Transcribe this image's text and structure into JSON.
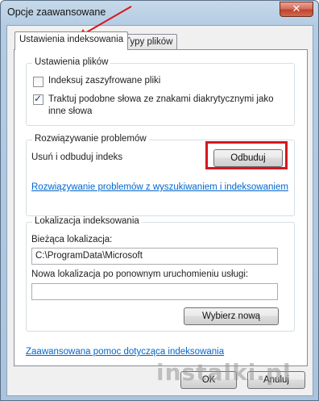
{
  "window": {
    "title": "Opcje zaawansowane",
    "close_glyph": "✕"
  },
  "tabs": [
    {
      "label": "Ustawienia indeksowania",
      "active": true
    },
    {
      "label": "Typy plików",
      "active": false
    }
  ],
  "file_settings": {
    "title": "Ustawienia plików",
    "options": [
      {
        "label": "Indeksuj zaszyfrowane pliki",
        "checked": false
      },
      {
        "label": "Traktuj podobne słowa ze znakami diakrytycznymi jako inne słowa",
        "checked": true
      }
    ]
  },
  "troubleshooting": {
    "title": "Rozwiązywanie problemów",
    "rebuild_label": "Usuń i odbuduj indeks",
    "rebuild_button": "Odbuduj",
    "help_link": "Rozwiązywanie problemów z wyszukiwaniem i indeksowaniem"
  },
  "index_location": {
    "title": "Lokalizacja indeksowania",
    "current_label": "Bieżąca lokalizacja:",
    "current_value": "C:\\ProgramData\\Microsoft",
    "new_label": "Nowa lokalizacja po ponownym uruchomieniu usługi:",
    "new_value": "",
    "select_button": "Wybierz nową"
  },
  "advanced_help_link": "Zaawansowana pomoc dotycząca indeksowania",
  "footer": {
    "ok_label": "OK",
    "cancel_label": "Anuluj"
  },
  "watermark": "instalki.pl",
  "colors": {
    "highlight": "#d6161f",
    "link": "#0066cc"
  }
}
